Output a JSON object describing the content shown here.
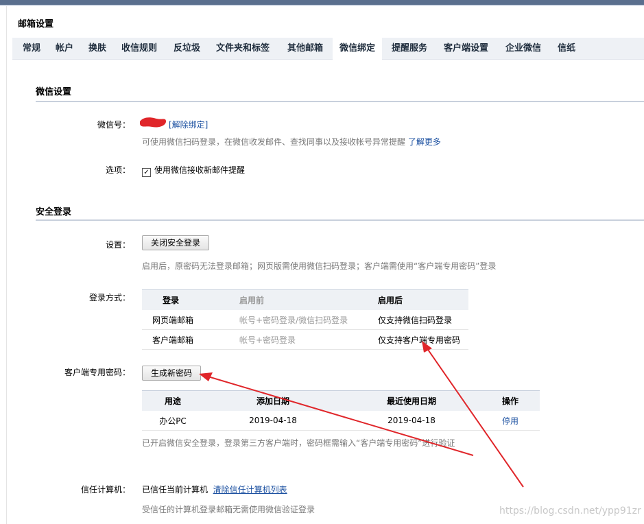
{
  "page_title": "邮箱设置",
  "tabs": [
    "常规",
    "帐户",
    "换肤",
    "收信规则",
    "反垃圾",
    "文件夹和标签",
    "其他邮箱",
    "微信绑定",
    "提醒服务",
    "客户端设置",
    "企业微信",
    "信纸"
  ],
  "active_tab": "微信绑定",
  "wechat": {
    "section_title": "微信设置",
    "id_label": "微信号：",
    "unbind_link": "[解除绑定]",
    "id_hint": "可使用微信扫码登录，在微信收发邮件、查找同事以及接收帐号异常提醒",
    "learn_more": "了解更多",
    "option_label": "选项：",
    "option_checkbox": "使用微信接收新邮件提醒"
  },
  "secure": {
    "section_title": "安全登录",
    "setting_label": "设置：",
    "close_button": "关闭安全登录",
    "setting_hint": "启用后，原密码无法登录邮箱；网页版需使用微信扫码登录；客户端需使用“客户端专用密码”登录",
    "method_label": "登录方式：",
    "method_table": {
      "headers": [
        "登录",
        "启用前",
        "启用后"
      ],
      "rows": [
        [
          "网页端邮箱",
          "帐号+密码登录/微信扫码登录",
          "仅支持微信扫码登录"
        ],
        [
          "客户端邮箱",
          "帐号+密码登录",
          "仅支持客户端专用密码"
        ]
      ]
    },
    "client_pwd_label": "客户端专用密码：",
    "generate_button": "生成新密码",
    "pwd_table": {
      "headers": [
        "用途",
        "添加日期",
        "最近使用日期",
        "操作"
      ],
      "rows": [
        [
          "办公PC",
          "2019-04-18",
          "2019-04-18",
          "停用"
        ]
      ]
    },
    "pwd_hint": "已开启微信安全登录，登录第三方客户端时，密码框需输入“客户端专用密码”进行验证",
    "trust_label": "信任计算机：",
    "trust_text": "已信任当前计算机",
    "trust_clear_link": "清除信任计算机列表",
    "trust_hint": "受信任的计算机登录邮箱无需使用微信验证登录"
  },
  "watermark": "https://blog.csdn.net/ypp91zr",
  "colors": {
    "arrow": "#e0262a",
    "link": "#1a4fa0",
    "header_bg": "#eef1f5"
  }
}
